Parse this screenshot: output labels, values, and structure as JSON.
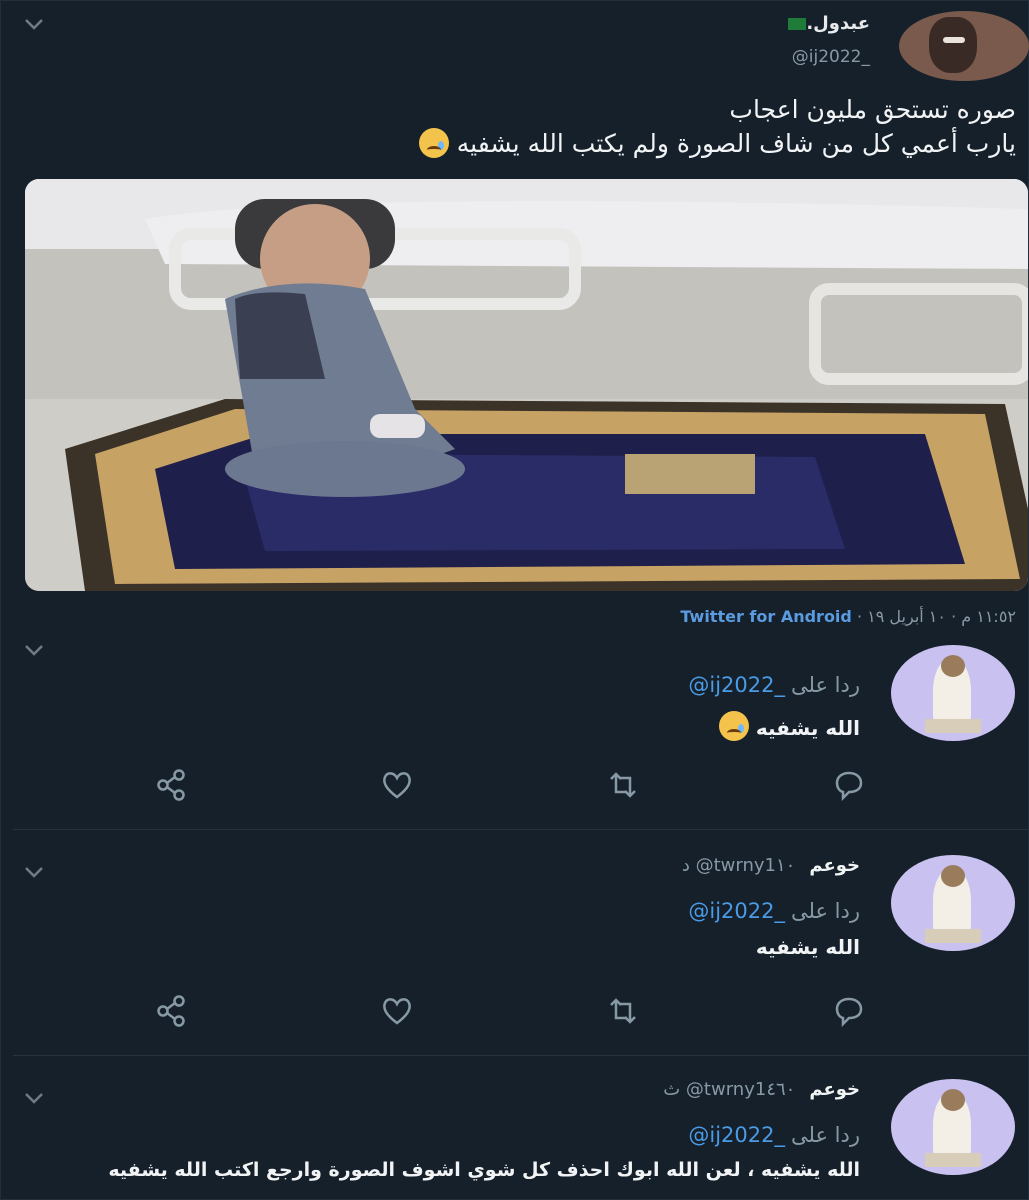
{
  "main_tweet": {
    "name": "عبدول.",
    "handle": "@ij2022_",
    "text_line1": "صوره تستحق مليون اعجاب",
    "text_line2": "يارب أعمي كل من شاف الصورة ولم يكتب الله يشفيه",
    "timestamp": "١١:٥٢ م · ١٠ أبريل ١٩ ·",
    "source": "Twitter for Android"
  },
  "replies": [
    {
      "name": "",
      "handle": "",
      "time": "",
      "replying_label": "ردا على",
      "replying_to": "@ij2022_",
      "text": "الله يشفيه"
    },
    {
      "name": "خوعم",
      "handle": "@twrny1",
      "time": "١٠ د",
      "replying_label": "ردا على",
      "replying_to": "@ij2022_",
      "text": "الله يشفيه"
    },
    {
      "name": "خوعم",
      "handle": "@twrny1",
      "time": "٤٦٠ ث",
      "replying_label": "ردا على",
      "replying_to": "@ij2022_",
      "text": "الله يشفيه ، لعن الله ابوك احذف كل شوي اشوف الصورة وارجع اكتب الله يشفيه"
    }
  ],
  "icons": [
    "chevron-down-icon",
    "share-icon",
    "like-icon",
    "retweet-icon",
    "reply-icon",
    "crying-face-emoji"
  ],
  "colors": {
    "background": "#15202b",
    "link": "#4a9be6",
    "muted": "#8899a6"
  }
}
